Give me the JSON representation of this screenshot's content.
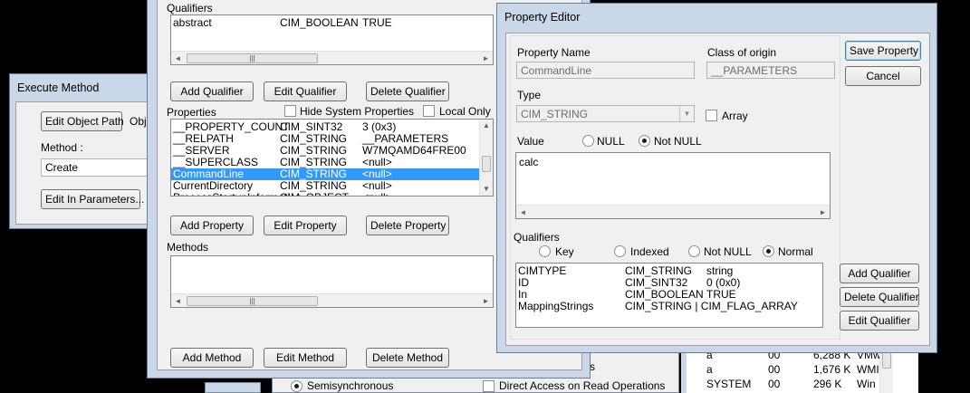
{
  "execute_method": {
    "title": "Execute Method",
    "edit_object_path_button": "Edit Object Path",
    "object_label_partial": "Obje",
    "method_label": "Method :",
    "method_value": "Create",
    "edit_in_params_button": "Edit In Parameters..."
  },
  "object_editor": {
    "qualifiers_label": "Qualifiers",
    "qualifiers_rows": [
      {
        "name": "abstract",
        "type": "CIM_BOOLEAN",
        "value": "TRUE"
      }
    ],
    "add_qualifier": "Add Qualifier",
    "edit_qualifier": "Edit Qualifier",
    "delete_qualifier": "Delete Qualifier",
    "properties_label": "Properties",
    "hide_system_properties": "Hide System Properties",
    "local_only": "Local Only",
    "properties_rows": [
      {
        "name": "__PROPERTY_COUNT",
        "type": "CIM_SINT32",
        "value": "3 (0x3)"
      },
      {
        "name": "__RELPATH",
        "type": "CIM_STRING",
        "value": "__PARAMETERS"
      },
      {
        "name": "__SERVER",
        "type": "CIM_STRING",
        "value": "W7MQAMD64FRE00"
      },
      {
        "name": "__SUPERCLASS",
        "type": "CIM_STRING",
        "value": "<null>"
      },
      {
        "name": "CommandLine",
        "type": "CIM_STRING",
        "value": "<null>"
      },
      {
        "name": "CurrentDirectory",
        "type": "CIM_STRING",
        "value": "<null>"
      },
      {
        "name": "ProcessStartupInformation",
        "type": "CIM_OBJECT",
        "value": "<null>"
      }
    ],
    "selected_property_index": 4,
    "add_property": "Add Property",
    "edit_property": "Edit Property",
    "delete_property": "Delete Property",
    "methods_label": "Methods",
    "add_method": "Add Method",
    "edit_method": "Edit Method",
    "delete_method": "Delete Method"
  },
  "background": {
    "semisynchronous": "Semisynchronous",
    "direct_access": "Direct Access on Read Operations",
    "partial_rs": "rs",
    "task_rows": [
      {
        "name": "a",
        "session": "00",
        "mem": "6,288 K",
        "desc": "VMw"
      },
      {
        "name": "a",
        "session": "00",
        "mem": "1,676 K",
        "desc": "WMI"
      },
      {
        "name": "SYSTEM",
        "session": "00",
        "mem": "296 K",
        "desc": "Win"
      }
    ]
  },
  "property_editor": {
    "title": "Property Editor",
    "property_name_label": "Property Name",
    "property_name_value": "CommandLine",
    "class_of_origin_label": "Class of origin",
    "class_of_origin_value": "__PARAMETERS",
    "save_property": "Save Property",
    "cancel": "Cancel",
    "type_label": "Type",
    "type_value": "CIM_STRING",
    "array_label": "Array",
    "value_label": "Value",
    "null_label": "NULL",
    "not_null_label": "Not NULL",
    "value_text": "calc",
    "qualifiers_label": "Qualifiers",
    "key_label": "Key",
    "indexed_label": "Indexed",
    "q_not_null_label": "Not NULL",
    "normal_label": "Normal",
    "qualifier_rows": [
      {
        "name": "CIMTYPE",
        "type": "CIM_STRING",
        "value": "string"
      },
      {
        "name": "ID",
        "type": "CIM_SINT32",
        "value": "0 (0x0)"
      },
      {
        "name": "In",
        "type": "CIM_BOOLEAN",
        "value": "TRUE"
      },
      {
        "name": "MappingStrings",
        "type": "CIM_STRING | CIM_FLAG_ARRAY",
        "value": ""
      }
    ],
    "add_qualifier": "Add Qualifier",
    "delete_qualifier": "Delete Qualifier",
    "edit_qualifier": "Edit Qualifier"
  },
  "colors": {
    "selection": "#3399ff",
    "dialog_bg": "#f0f0f0",
    "frame": "#c9d7e8"
  }
}
